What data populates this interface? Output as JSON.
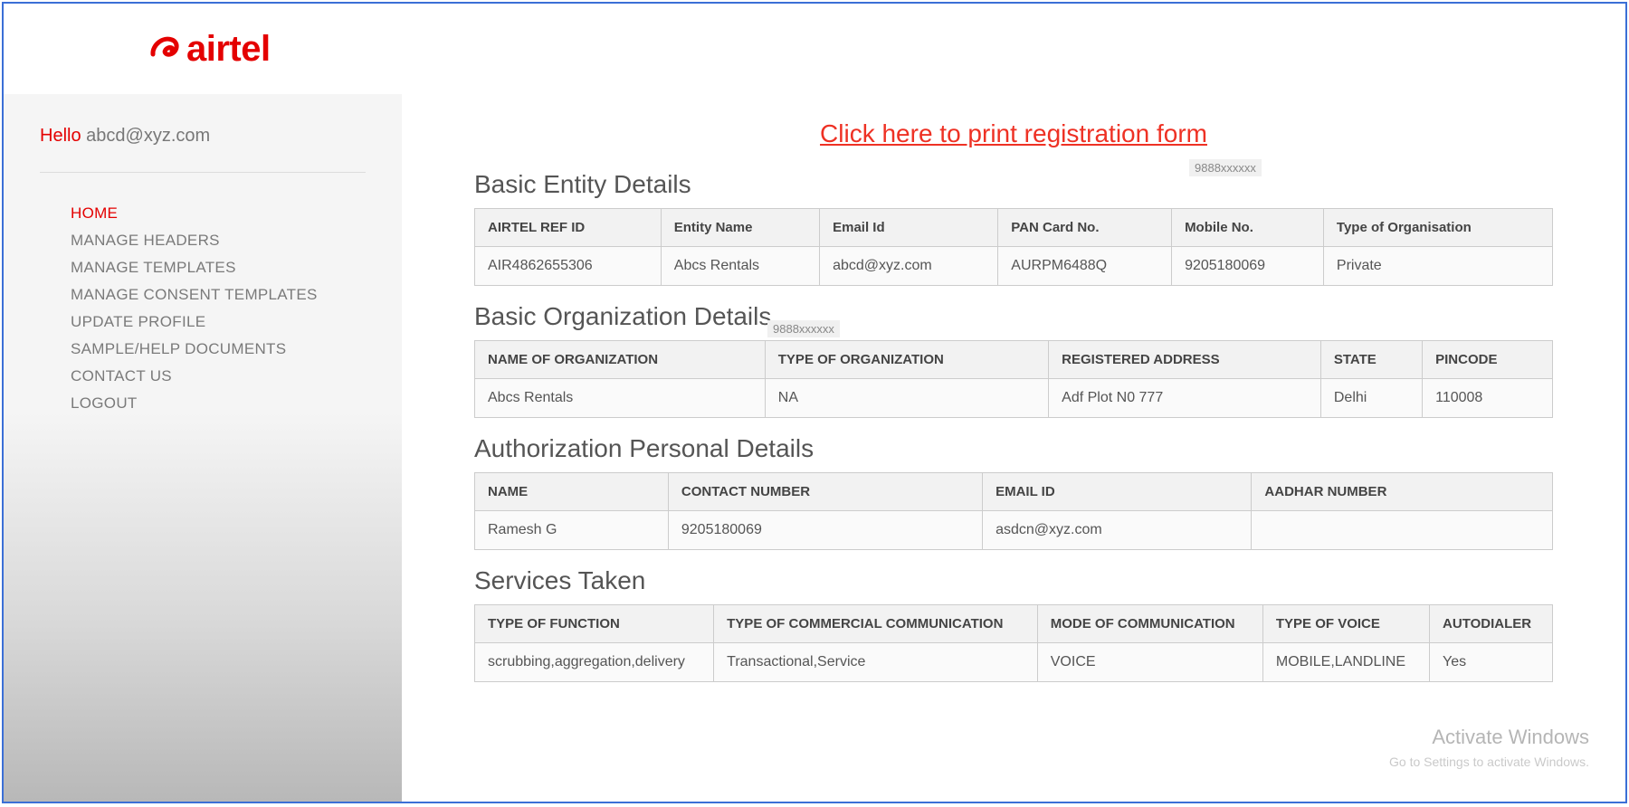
{
  "brand": {
    "name": "airtel"
  },
  "sidebar": {
    "hello_prefix": "Hello",
    "user_email": "abcd@xyz.com",
    "nav": [
      {
        "label": "HOME",
        "active": true
      },
      {
        "label": "MANAGE HEADERS",
        "active": false
      },
      {
        "label": "MANAGE TEMPLATES",
        "active": false
      },
      {
        "label": "MANAGE CONSENT TEMPLATES",
        "active": false
      },
      {
        "label": "UPDATE PROFILE",
        "active": false
      },
      {
        "label": "SAMPLE/HELP DOCUMENTS",
        "active": false
      },
      {
        "label": "CONTACT US",
        "active": false
      },
      {
        "label": "LOGOUT",
        "active": false
      }
    ]
  },
  "print_link": "Click here to print registration form",
  "overlay_tags": {
    "top": "9888xxxxxx",
    "mid": "9888xxxxxx"
  },
  "sections": {
    "entity": {
      "title": "Basic Entity Details",
      "headers": [
        "AIRTEL REF ID",
        "Entity Name",
        "Email Id",
        "PAN Card No.",
        "Mobile No.",
        "Type of Organisation"
      ],
      "row": [
        "AIR4862655306",
        "Abcs Rentals",
        "abcd@xyz.com",
        "AURPM6488Q",
        "9205180069",
        "Private"
      ]
    },
    "org": {
      "title": "Basic Organization Details",
      "headers": [
        "NAME OF ORGANIZATION",
        "TYPE OF ORGANIZATION",
        "REGISTERED ADDRESS",
        "STATE",
        "PINCODE"
      ],
      "row": [
        "Abcs Rentals",
        "NA",
        "Adf Plot N0 777",
        "Delhi",
        "110008"
      ]
    },
    "auth": {
      "title": "Authorization Personal Details",
      "headers": [
        "NAME",
        "CONTACT NUMBER",
        "EMAIL ID",
        "AADHAR NUMBER"
      ],
      "row": [
        "Ramesh G",
        "9205180069",
        "asdcn@xyz.com",
        ""
      ]
    },
    "services": {
      "title": "Services Taken",
      "headers": [
        "TYPE OF FUNCTION",
        "TYPE OF COMMERCIAL COMMUNICATION",
        "MODE OF COMMUNICATION",
        "TYPE OF VOICE",
        "AUTODIALER"
      ],
      "row": [
        "scrubbing,aggregation,delivery",
        "Transactional,Service",
        "VOICE",
        "MOBILE,LANDLINE",
        "Yes"
      ]
    }
  },
  "watermark": {
    "title": "Activate Windows",
    "sub": "Go to Settings to activate Windows."
  }
}
